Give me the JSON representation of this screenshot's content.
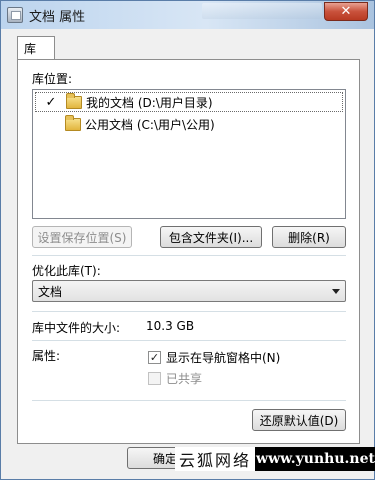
{
  "window": {
    "title": "文档 属性",
    "close_glyph": "✕"
  },
  "tabs": [
    {
      "label": "库"
    }
  ],
  "library_locations": {
    "label": "库位置:",
    "items": [
      {
        "check": "✓",
        "text": "我的文档 (D:\\用户目录)",
        "selected": true
      },
      {
        "check": "",
        "text": "公用文档 (C:\\用户\\公用)",
        "selected": false
      }
    ]
  },
  "buttons": {
    "set_save_location": "设置保存位置(S)",
    "include_folder": "包含文件夹(I)...",
    "remove": "删除(R)",
    "restore_defaults": "还原默认值(D)",
    "ok": "确定"
  },
  "optimize": {
    "label": "优化此库(T):",
    "selected": "文档"
  },
  "size": {
    "label": "库中文件的大小:",
    "value": "10.3 GB"
  },
  "attributes": {
    "label": "属性:",
    "show_in_nav": {
      "label": "显示在导航窗格中(N)",
      "checked": true
    },
    "shared": {
      "label": "已共享",
      "checked": false,
      "disabled": true
    }
  },
  "watermark": {
    "chinese": "云狐网络",
    "url": "www.yunhu.net"
  }
}
